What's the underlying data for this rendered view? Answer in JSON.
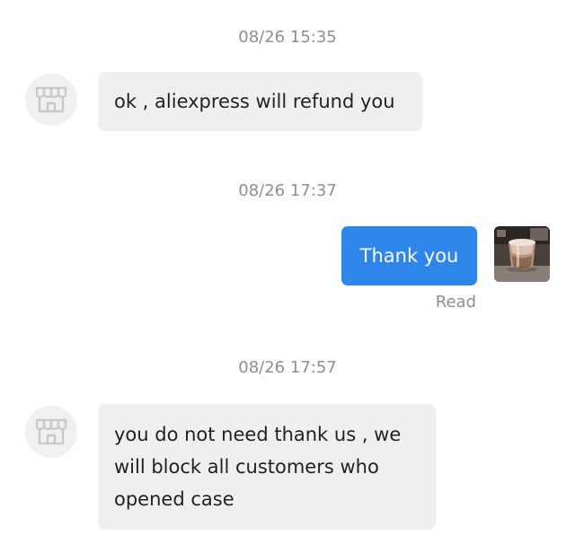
{
  "messages": [
    {
      "timestamp": "08/26 15:35",
      "sender": "seller",
      "text": "ok , aliexpress will refund you"
    },
    {
      "timestamp": "08/26 17:37",
      "sender": "me",
      "text": "Thank you",
      "status": "Read"
    },
    {
      "timestamp": "08/26 17:57",
      "sender": "seller",
      "text": "you do not need thank us , we will block all customers who opened case"
    }
  ],
  "icons": {
    "seller_avatar": "store-icon",
    "user_avatar": "coffee-cup-photo"
  },
  "colors": {
    "outgoing_bubble": "#2f86ea",
    "incoming_bubble": "#efefef",
    "meta_text": "#8e8e93"
  }
}
